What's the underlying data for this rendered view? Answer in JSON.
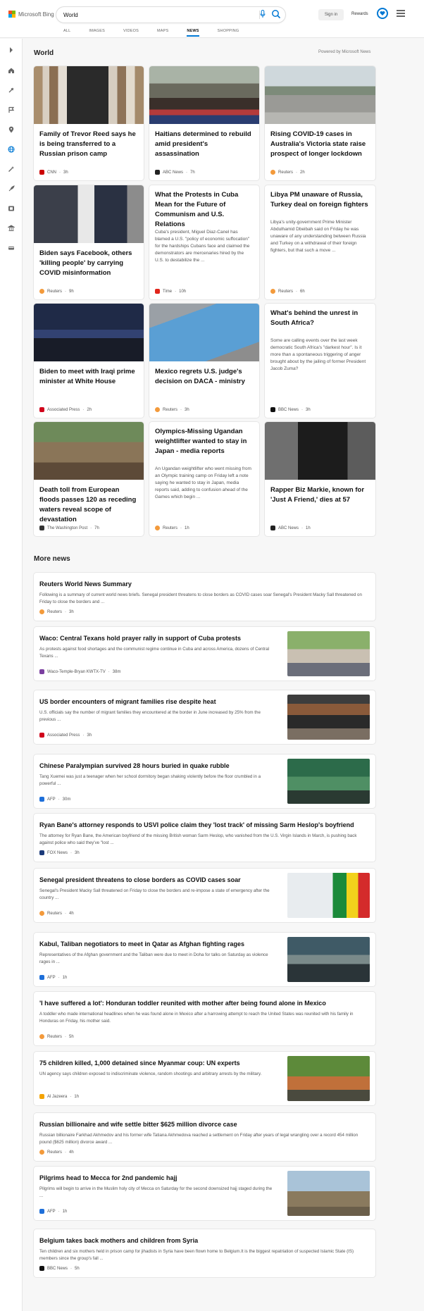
{
  "header": {
    "logo_text": "Microsoft Bing",
    "search_value": "World",
    "signin_label": "Sign in",
    "rewards_label": "Rewards"
  },
  "tabs": [
    {
      "label": "ALL"
    },
    {
      "label": "IMAGES"
    },
    {
      "label": "VIDEOS"
    },
    {
      "label": "MAPS"
    },
    {
      "label": "NEWS",
      "active": true
    },
    {
      "label": "SHOPPING"
    }
  ],
  "section": {
    "title": "World",
    "powered_by": "Powered by Microsoft News",
    "more_title": "More news"
  },
  "cards": [
    {
      "title": "Family of Trevor Reed says he is being transferred to a Russian prison camp",
      "desc": "",
      "source": "CNN",
      "age": "3h",
      "icon_color": "#cc0000"
    },
    {
      "title": "Haitians determined to rebuild amid president's assassination",
      "desc": "",
      "source": "ABC News",
      "age": "7h",
      "icon_color": "#222222"
    },
    {
      "title": "Rising COVID-19 cases in Australia's Victoria state raise prospect of longer lockdown",
      "desc": "",
      "source": "Reuters",
      "age": "2h",
      "icon_color": "#f39a3b"
    },
    {
      "title": "Biden says Facebook, others 'killing people' by carrying COVID misinformation",
      "desc": "",
      "source": "Reuters",
      "age": "9h",
      "icon_color": "#f39a3b"
    },
    {
      "title": "What the Protests in Cuba Mean for the Future of Communism and U.S. Relations",
      "desc": "Cuba's president, Miguel Diaz-Canel has blamed a U.S. \"policy of economic suffocation\" for the hardships Cubans face and claimed the demonstrators are mercenaries hired by the U.S. to destabilize the ...",
      "source": "Time",
      "age": "10h",
      "icon_color": "#e1251b"
    },
    {
      "title": "Libya PM unaware of Russia, Turkey deal on foreign fighters",
      "desc": "Libya's unity-government Prime Minister Abdulhamid Dbeibah said on Friday he was unaware of any understanding between Russia and Turkey on a withdrawal of their foreign fighters, but that such a move ...",
      "source": "Reuters",
      "age": "6h",
      "icon_color": "#f39a3b"
    },
    {
      "title": "Biden to meet with Iraqi prime minister at White House",
      "desc": "",
      "source": "Associated Press",
      "age": "2h",
      "icon_color": "#d0021b"
    },
    {
      "title": "Mexico regrets U.S. judge's decision on DACA - ministry",
      "desc": "",
      "source": "Reuters",
      "age": "3h",
      "icon_color": "#f39a3b"
    },
    {
      "title": "What's behind the unrest in South Africa?",
      "desc": "Some are calling events over the last week democratic South Africa's \"darkest hour\". Is it more than a spontaneous triggering of anger brought about by the jailing of former President Jacob Zuma?",
      "source": "BBC News",
      "age": "3h",
      "icon_color": "#111111"
    },
    {
      "title": "Death toll from European floods passes 120 as receding waters reveal scope of devastation",
      "desc": "",
      "source": "The Washington Post",
      "age": "7h",
      "icon_color": "#333333"
    },
    {
      "title": "Olympics-Missing Ugandan weightlifter wanted to stay in Japan - media reports",
      "desc": "An Ugandan weightlifter who went missing from an Olympic training camp on Friday left a note saying he wanted to stay in Japan, media reports said, adding to confusion ahead of the Games which begin ...",
      "source": "Reuters",
      "age": "1h",
      "icon_color": "#f39a3b"
    },
    {
      "title": "Rapper Biz Markie, known for 'Just A Friend,' dies at 57",
      "desc": "",
      "source": "ABC News",
      "age": "1h",
      "icon_color": "#222222"
    }
  ],
  "more_news": [
    {
      "title": "Reuters World News Summary",
      "desc": "Following is a summary of current world news briefs. Senegal president threatens to close borders as COVID cases soar Senegal's President Macky Sall threatened on Friday to close the borders and ...",
      "source": "Reuters",
      "age": "3h",
      "icon_color": "#f39a3b",
      "has_image": false
    },
    {
      "title": "Waco: Central Texans hold prayer rally in support of Cuba protests",
      "desc": "As protests against food shortages and the communist regime continue in Cuba and across America, dozens of Central Texans ...",
      "source": "Waco-Temple-Bryan KWTX-TV",
      "age": "38m",
      "icon_color": "#7b3fa0",
      "has_image": true
    },
    {
      "title": "US border encounters of migrant families rise despite heat",
      "desc": "U.S. officials say the number of migrant families they encountered at the border in June increased by 25% from the previous ...",
      "source": "Associated Press",
      "age": "3h",
      "icon_color": "#d0021b",
      "has_image": true
    },
    {
      "title": "Chinese Paralympian survived 28 hours buried in quake rubble",
      "desc": "Tang Xuemei was just a teenager when her school dormitory began shaking violently before the floor crumbled in a powerful ...",
      "source": "AFP",
      "age": "30m",
      "icon_color": "#1e6fd9",
      "has_image": true
    },
    {
      "title": "Ryan Bane's attorney responds to USVI police claim they 'lost track' of missing Sarm Heslop's boyfriend",
      "desc": "The attorney for Ryan Bane, the American boyfriend of the missing British woman Sarm Heslop, who vanished from the U.S. Virgin Islands in March, is pushing back against police who said they've \"lost ...",
      "source": "FOX News",
      "age": "3h",
      "icon_color": "#1b3a7a",
      "has_image": false
    },
    {
      "title": "Senegal president threatens to close borders as COVID cases soar",
      "desc": "Senegal's President Macky Sall threatened on Friday to close the borders and re-impose a state of emergency after the country ...",
      "source": "Reuters",
      "age": "4h",
      "icon_color": "#f39a3b",
      "has_image": true
    },
    {
      "title": "Kabul, Taliban negotiators to meet in Qatar as Afghan fighting rages",
      "desc": "Representatives of the Afghan government and the Taliban were due to meet in Doha for talks on Saturday as violence rages in ...",
      "source": "AFP",
      "age": "1h",
      "icon_color": "#1e6fd9",
      "has_image": true
    },
    {
      "title": "'I have suffered a lot': Honduran toddler reunited with mother after being found alone in Mexico",
      "desc": "A toddler who made international headlines when he was found alone in Mexico after a harrowing attempt to reach the United States was reunited with his family in Honduras on Friday, his mother said.",
      "source": "Reuters",
      "age": "5h",
      "icon_color": "#f39a3b",
      "has_image": false
    },
    {
      "title": "75 children killed, 1,000 detained since Myanmar coup: UN experts",
      "desc": "UN agency says children exposed to indiscriminate violence, random shootings and arbitrary arrests by the military.",
      "source": "Al Jazeera",
      "age": "1h",
      "icon_color": "#f4a300",
      "has_image": true
    },
    {
      "title": "Russian billionaire and wife settle bitter $625 million divorce case",
      "desc": "Russian billionaire Farkhad Akhmedov and his former wife Tatiana Akhmedova reached a settlement on Friday after years of legal wrangling over a record 454 million pound ($625 million) divorce award ...",
      "source": "Reuters",
      "age": "4h",
      "icon_color": "#f39a3b",
      "has_image": false
    },
    {
      "title": "Pilgrims head to Mecca for 2nd pandemic hajj",
      "desc": "Pilgrims will begin to arrive in the Muslim holy city of Mecca on Saturday for the second downsized hajj staged during the ...",
      "source": "AFP",
      "age": "1h",
      "icon_color": "#1e6fd9",
      "has_image": true
    },
    {
      "title": "Belgium takes back mothers and children from Syria",
      "desc": "Ten children and six mothers held in prison camp for jihadists in Syria have been flown home to Belgium.It is the biggest repatriation of suspected Islamic State (IS) members since the group's fall ...",
      "source": "BBC News",
      "age": "5h",
      "icon_color": "#111111",
      "has_image": false
    }
  ]
}
